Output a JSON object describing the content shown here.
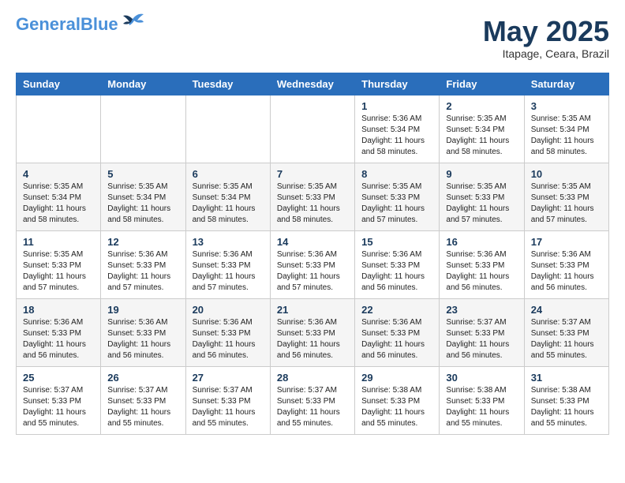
{
  "logo": {
    "line1": "General",
    "line2": "Blue"
  },
  "title": "May 2025",
  "subtitle": "Itapage, Ceara, Brazil",
  "headers": [
    "Sunday",
    "Monday",
    "Tuesday",
    "Wednesday",
    "Thursday",
    "Friday",
    "Saturday"
  ],
  "weeks": [
    [
      {
        "day": "",
        "info": ""
      },
      {
        "day": "",
        "info": ""
      },
      {
        "day": "",
        "info": ""
      },
      {
        "day": "",
        "info": ""
      },
      {
        "day": "1",
        "info": "Sunrise: 5:36 AM\nSunset: 5:34 PM\nDaylight: 11 hours\nand 58 minutes."
      },
      {
        "day": "2",
        "info": "Sunrise: 5:35 AM\nSunset: 5:34 PM\nDaylight: 11 hours\nand 58 minutes."
      },
      {
        "day": "3",
        "info": "Sunrise: 5:35 AM\nSunset: 5:34 PM\nDaylight: 11 hours\nand 58 minutes."
      }
    ],
    [
      {
        "day": "4",
        "info": "Sunrise: 5:35 AM\nSunset: 5:34 PM\nDaylight: 11 hours\nand 58 minutes."
      },
      {
        "day": "5",
        "info": "Sunrise: 5:35 AM\nSunset: 5:34 PM\nDaylight: 11 hours\nand 58 minutes."
      },
      {
        "day": "6",
        "info": "Sunrise: 5:35 AM\nSunset: 5:34 PM\nDaylight: 11 hours\nand 58 minutes."
      },
      {
        "day": "7",
        "info": "Sunrise: 5:35 AM\nSunset: 5:33 PM\nDaylight: 11 hours\nand 58 minutes."
      },
      {
        "day": "8",
        "info": "Sunrise: 5:35 AM\nSunset: 5:33 PM\nDaylight: 11 hours\nand 57 minutes."
      },
      {
        "day": "9",
        "info": "Sunrise: 5:35 AM\nSunset: 5:33 PM\nDaylight: 11 hours\nand 57 minutes."
      },
      {
        "day": "10",
        "info": "Sunrise: 5:35 AM\nSunset: 5:33 PM\nDaylight: 11 hours\nand 57 minutes."
      }
    ],
    [
      {
        "day": "11",
        "info": "Sunrise: 5:35 AM\nSunset: 5:33 PM\nDaylight: 11 hours\nand 57 minutes."
      },
      {
        "day": "12",
        "info": "Sunrise: 5:36 AM\nSunset: 5:33 PM\nDaylight: 11 hours\nand 57 minutes."
      },
      {
        "day": "13",
        "info": "Sunrise: 5:36 AM\nSunset: 5:33 PM\nDaylight: 11 hours\nand 57 minutes."
      },
      {
        "day": "14",
        "info": "Sunrise: 5:36 AM\nSunset: 5:33 PM\nDaylight: 11 hours\nand 57 minutes."
      },
      {
        "day": "15",
        "info": "Sunrise: 5:36 AM\nSunset: 5:33 PM\nDaylight: 11 hours\nand 56 minutes."
      },
      {
        "day": "16",
        "info": "Sunrise: 5:36 AM\nSunset: 5:33 PM\nDaylight: 11 hours\nand 56 minutes."
      },
      {
        "day": "17",
        "info": "Sunrise: 5:36 AM\nSunset: 5:33 PM\nDaylight: 11 hours\nand 56 minutes."
      }
    ],
    [
      {
        "day": "18",
        "info": "Sunrise: 5:36 AM\nSunset: 5:33 PM\nDaylight: 11 hours\nand 56 minutes."
      },
      {
        "day": "19",
        "info": "Sunrise: 5:36 AM\nSunset: 5:33 PM\nDaylight: 11 hours\nand 56 minutes."
      },
      {
        "day": "20",
        "info": "Sunrise: 5:36 AM\nSunset: 5:33 PM\nDaylight: 11 hours\nand 56 minutes."
      },
      {
        "day": "21",
        "info": "Sunrise: 5:36 AM\nSunset: 5:33 PM\nDaylight: 11 hours\nand 56 minutes."
      },
      {
        "day": "22",
        "info": "Sunrise: 5:36 AM\nSunset: 5:33 PM\nDaylight: 11 hours\nand 56 minutes."
      },
      {
        "day": "23",
        "info": "Sunrise: 5:37 AM\nSunset: 5:33 PM\nDaylight: 11 hours\nand 56 minutes."
      },
      {
        "day": "24",
        "info": "Sunrise: 5:37 AM\nSunset: 5:33 PM\nDaylight: 11 hours\nand 55 minutes."
      }
    ],
    [
      {
        "day": "25",
        "info": "Sunrise: 5:37 AM\nSunset: 5:33 PM\nDaylight: 11 hours\nand 55 minutes."
      },
      {
        "day": "26",
        "info": "Sunrise: 5:37 AM\nSunset: 5:33 PM\nDaylight: 11 hours\nand 55 minutes."
      },
      {
        "day": "27",
        "info": "Sunrise: 5:37 AM\nSunset: 5:33 PM\nDaylight: 11 hours\nand 55 minutes."
      },
      {
        "day": "28",
        "info": "Sunrise: 5:37 AM\nSunset: 5:33 PM\nDaylight: 11 hours\nand 55 minutes."
      },
      {
        "day": "29",
        "info": "Sunrise: 5:38 AM\nSunset: 5:33 PM\nDaylight: 11 hours\nand 55 minutes."
      },
      {
        "day": "30",
        "info": "Sunrise: 5:38 AM\nSunset: 5:33 PM\nDaylight: 11 hours\nand 55 minutes."
      },
      {
        "day": "31",
        "info": "Sunrise: 5:38 AM\nSunset: 5:33 PM\nDaylight: 11 hours\nand 55 minutes."
      }
    ]
  ]
}
